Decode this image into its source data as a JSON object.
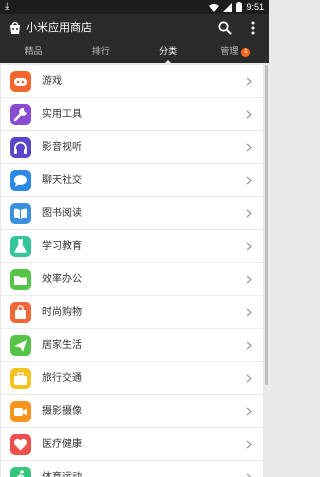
{
  "status_bar": {
    "time": "9:51"
  },
  "app_bar": {
    "title": "小米应用商店"
  },
  "tabs": [
    {
      "label": "精品"
    },
    {
      "label": "排行"
    },
    {
      "label": "分类"
    },
    {
      "label": "管理",
      "badge": "1"
    }
  ],
  "categories": [
    {
      "label": "游戏",
      "icon": "gamepad-icon",
      "color": "#f2672e"
    },
    {
      "label": "实用工具",
      "icon": "wrench-icon",
      "color": "#8a4bd1"
    },
    {
      "label": "影音视听",
      "icon": "headphones-icon",
      "color": "#5b45c8"
    },
    {
      "label": "聊天社交",
      "icon": "chat-bubble-icon",
      "color": "#2c88e6"
    },
    {
      "label": "图书阅读",
      "icon": "book-icon",
      "color": "#3d8fe0"
    },
    {
      "label": "学习教育",
      "icon": "flask-icon",
      "color": "#35c59a"
    },
    {
      "label": "效率办公",
      "icon": "folder-icon",
      "color": "#55c447"
    },
    {
      "label": "时尚购物",
      "icon": "shopping-bag-icon",
      "color": "#f0673a"
    },
    {
      "label": "居家生活",
      "icon": "paper-plane-icon",
      "color": "#55c447"
    },
    {
      "label": "旅行交通",
      "icon": "suitcase-icon",
      "color": "#f5c21f"
    },
    {
      "label": "摄影摄像",
      "icon": "video-camera-icon",
      "color": "#f7941d"
    },
    {
      "label": "医疗健康",
      "icon": "heart-icon",
      "color": "#ef4f4a"
    },
    {
      "label": "体育运动",
      "icon": "running-icon",
      "color": "#35c57a"
    }
  ]
}
